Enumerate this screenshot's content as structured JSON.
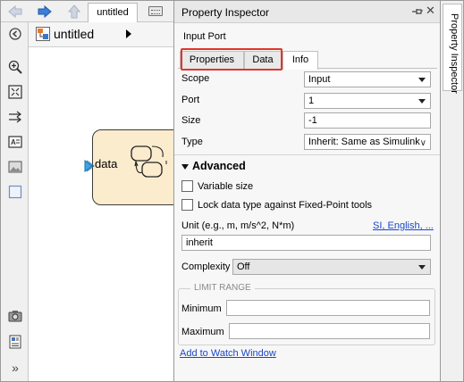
{
  "editor": {
    "doc_tab_label": "untitled",
    "path_label": "untitled",
    "port_label": "data"
  },
  "inspector": {
    "title": "Property Inspector",
    "block_type": "Input Port",
    "tabs": [
      "Properties",
      "Data",
      "Info"
    ],
    "selected_tab": "Info",
    "highlighted_tabs": [
      "Properties",
      "Data"
    ],
    "highlight_color": "#e0352b",
    "fields": {
      "scope": {
        "label": "Scope",
        "value": "Input"
      },
      "port": {
        "label": "Port",
        "value": "1"
      },
      "size": {
        "label": "Size",
        "value": "-1"
      },
      "type": {
        "label": "Type",
        "value": "Inherit: Same as Simulink"
      }
    },
    "advanced": {
      "title": "Advanced",
      "variable_size": {
        "label": "Variable size",
        "checked": false
      },
      "lock_type": {
        "label": "Lock data type against Fixed-Point tools",
        "checked": false
      },
      "unit_label": "Unit (e.g., m, m/s^2, N*m)",
      "unit_link": "SI, English, ...",
      "unit_value": "inherit",
      "complexity_label": "Complexity",
      "complexity_value": "Off"
    },
    "limit_range": {
      "title": "LIMIT RANGE",
      "minimum_label": "Minimum",
      "minimum_value": "",
      "maximum_label": "Maximum",
      "maximum_value": ""
    },
    "watch_link": "Add to Watch Window"
  },
  "side_strip": {
    "label": "Property Inspector"
  },
  "icons": [
    "back-arrow-icon",
    "forward-arrow-icon",
    "up-arrow-icon",
    "keyboard-icon",
    "hide-browser-icon",
    "zoom-in-icon",
    "fit-view-icon",
    "arrows-icon",
    "annotation-icon",
    "image-icon",
    "box-icon",
    "camera-icon",
    "report-icon",
    "more-icon",
    "model-icon",
    "pin-icon",
    "close-icon"
  ]
}
